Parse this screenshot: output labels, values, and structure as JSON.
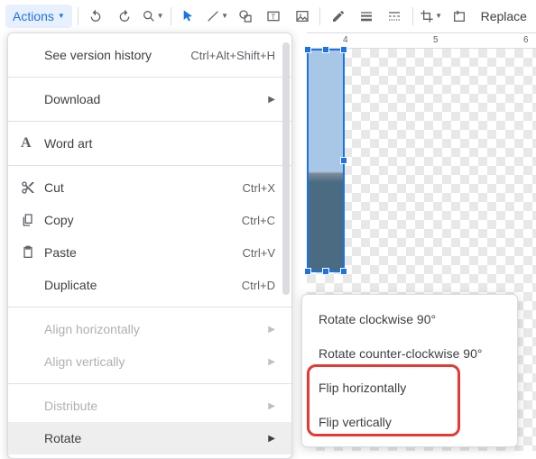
{
  "toolbar": {
    "actions_label": "Actions",
    "replace_label": "Replace"
  },
  "ruler": {
    "t4": "4",
    "t5": "5",
    "t6": "6"
  },
  "menu": {
    "version_history": "See version history",
    "version_history_shortcut": "Ctrl+Alt+Shift+H",
    "download": "Download",
    "word_art": "Word art",
    "cut": "Cut",
    "cut_shortcut": "Ctrl+X",
    "copy": "Copy",
    "copy_shortcut": "Ctrl+C",
    "paste": "Paste",
    "paste_shortcut": "Ctrl+V",
    "duplicate": "Duplicate",
    "duplicate_shortcut": "Ctrl+D",
    "align_h": "Align horizontally",
    "align_v": "Align vertically",
    "distribute": "Distribute",
    "rotate": "Rotate"
  },
  "submenu": {
    "rotate_cw": "Rotate clockwise 90°",
    "rotate_ccw": "Rotate counter-clockwise 90°",
    "flip_h": "Flip horizontally",
    "flip_v": "Flip vertically"
  }
}
